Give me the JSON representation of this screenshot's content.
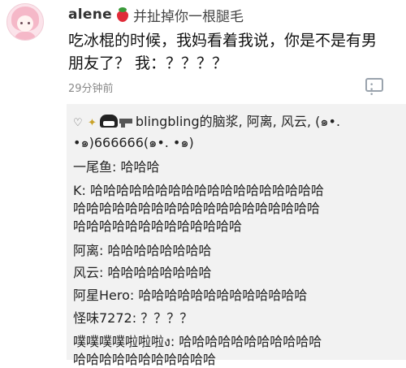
{
  "comment": {
    "username": "alene",
    "title": "并扯掉你一根腿毛",
    "text_line1": "吃冰棍的时候，我妈看着我说，你是不是有男",
    "text_line2": "朋友了？ 我：？？？？",
    "timestamp": "29分钟前"
  },
  "replies": {
    "header_line1": "blingbling的脑浆, 阿离, 风云, (๑•.",
    "header_line2": "•๑)666666(๑•. •๑)",
    "items": [
      {
        "text": "一尾鱼: 哈哈哈"
      },
      {
        "text": "K: 哈哈哈哈哈哈哈哈哈哈哈哈哈哈哈哈哈哈"
      },
      {
        "text": "哈哈哈哈哈哈哈哈哈哈哈哈哈哈哈哈哈哈哈"
      },
      {
        "text": "哈哈哈哈哈哈哈哈哈哈哈哈哈"
      },
      {
        "text": "阿离: 哈哈哈哈哈哈哈哈"
      },
      {
        "text": "风云: 哈哈哈哈哈哈哈哈"
      },
      {
        "text": "阿星Hero: 哈哈哈哈哈哈哈哈哈哈哈哈哈"
      },
      {
        "text": "怪味7272: ？？？？"
      },
      {
        "text": "噗噗噗噗啦啦啦ง: 哈哈哈哈哈哈哈哈哈哈哈"
      },
      {
        "text": "哈哈哈哈哈哈哈哈哈哈哈"
      }
    ]
  },
  "icons": {
    "avatar": "anime-girl-avatar",
    "badge": "strawberry-icon",
    "reply": "comment-reply-icon",
    "like": "heart-icon"
  },
  "colors": {
    "reply_bg": "#f2f2f2",
    "timestamp": "#8a8a8a",
    "strawberry": "#e02b38"
  }
}
